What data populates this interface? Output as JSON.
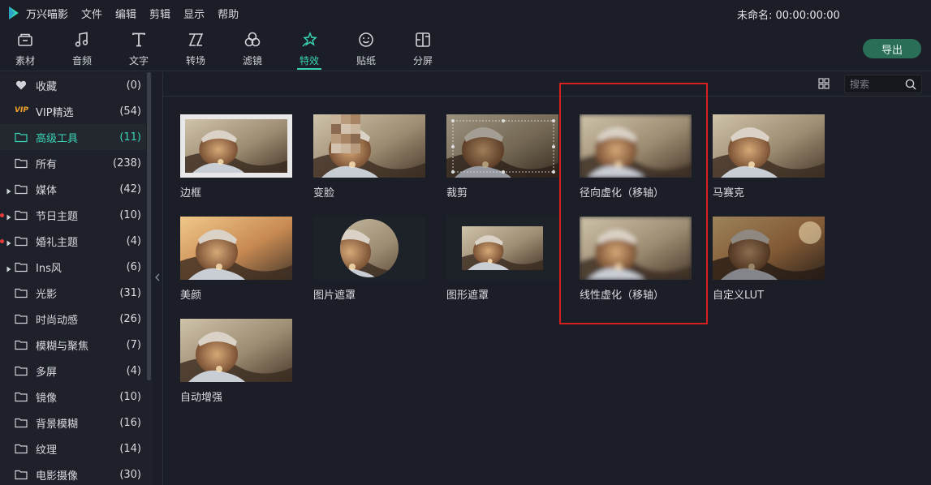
{
  "app": {
    "title": "万兴喵影",
    "project_title": "未命名: 00:00:00:00"
  },
  "menu": [
    "文件",
    "编辑",
    "剪辑",
    "显示",
    "帮助"
  ],
  "toolbar": {
    "tools": [
      {
        "label": "素材",
        "icon": "media-icon"
      },
      {
        "label": "音频",
        "icon": "music-note-icon"
      },
      {
        "label": "文字",
        "icon": "text-icon"
      },
      {
        "label": "转场",
        "icon": "transition-icon"
      },
      {
        "label": "滤镜",
        "icon": "filter-icon"
      },
      {
        "label": "特效",
        "icon": "effects-star-icon",
        "active": true
      },
      {
        "label": "贴纸",
        "icon": "sticker-face-icon"
      },
      {
        "label": "分屏",
        "icon": "split-screen-icon"
      }
    ],
    "export_label": "导出"
  },
  "sidebar": {
    "items": [
      {
        "label": "收藏",
        "count": "(0)",
        "icon": "heart-icon"
      },
      {
        "label": "VIP精选",
        "count": "(54)",
        "icon": "vip-badge",
        "badge": "VIP"
      },
      {
        "label": "高级工具",
        "count": "(11)",
        "icon": "folder-icon",
        "active": true
      },
      {
        "label": "所有",
        "count": "(238)",
        "icon": "folder-icon"
      },
      {
        "label": "媒体",
        "count": "(42)",
        "icon": "folder-icon",
        "expandable": true
      },
      {
        "label": "节日主题",
        "count": "(10)",
        "icon": "folder-icon",
        "expandable": true,
        "new_dot": true
      },
      {
        "label": "婚礼主题",
        "count": "(4)",
        "icon": "folder-icon",
        "expandable": true,
        "new_dot": true
      },
      {
        "label": "Ins风",
        "count": "(6)",
        "icon": "folder-icon",
        "expandable": true
      },
      {
        "label": "光影",
        "count": "(31)",
        "icon": "folder-icon"
      },
      {
        "label": "时尚动感",
        "count": "(26)",
        "icon": "folder-icon"
      },
      {
        "label": "模糊与聚焦",
        "count": "(7)",
        "icon": "folder-icon"
      },
      {
        "label": "多屏",
        "count": "(4)",
        "icon": "folder-icon"
      },
      {
        "label": "镜像",
        "count": "(10)",
        "icon": "folder-icon"
      },
      {
        "label": "背景模糊",
        "count": "(16)",
        "icon": "folder-icon"
      },
      {
        "label": "纹理",
        "count": "(14)",
        "icon": "folder-icon"
      },
      {
        "label": "电影摄像",
        "count": "(30)",
        "icon": "folder-icon"
      }
    ]
  },
  "search": {
    "placeholder": "搜索"
  },
  "effects": [
    {
      "label": "边框",
      "variant": "border"
    },
    {
      "label": "变脸",
      "variant": "mosaic"
    },
    {
      "label": "裁剪",
      "variant": "crop"
    },
    {
      "label": "径向虚化（移轴）",
      "variant": "blur"
    },
    {
      "label": "马赛克",
      "variant": "plain"
    },
    {
      "label": "美颜",
      "variant": "warm"
    },
    {
      "label": "图片遮罩",
      "variant": "circle"
    },
    {
      "label": "图形遮罩",
      "variant": "rect"
    },
    {
      "label": "线性虚化（移轴）",
      "variant": "blur"
    },
    {
      "label": "自定义LUT",
      "variant": "dark"
    },
    {
      "label": "自动增强",
      "variant": "plain"
    }
  ],
  "colors": {
    "accent": "#39d3b4",
    "highlight_box": "#d6201f",
    "export_bg": "#2b6e58",
    "vip": "#f3a52a"
  }
}
